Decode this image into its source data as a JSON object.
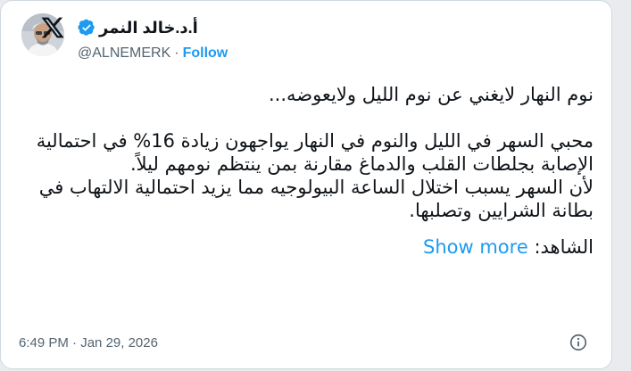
{
  "author": {
    "display_name": "أ.د.خالد النمر",
    "handle": "@ALNEMERK",
    "separator": "·",
    "follow_label": "Follow"
  },
  "tweet": {
    "paragraphs": [
      "نوم النهار لايغني عن نوم الليل ولايعوضه...",
      "",
      "محبي السهر في الليل والنوم في النهار يواجهون زيادة 16% في احتمالية الإصابة بجلطات القلب والدماغ مقارنة بمن ينتظم نومهم ليلاً.",
      "لأن السهر يسبب اختلال الساعة البيولوجيه مما يزيد احتمالية الالتهاب في بطانة الشرايين وتصلبها."
    ],
    "witness_label": "الشاهد:",
    "show_more_label": "Show more"
  },
  "footer": {
    "time": "6:49 PM",
    "separator": "·",
    "date": "Jan 29, 2026"
  },
  "colors": {
    "link": "#1d9bf0",
    "text": "#0f1419",
    "muted": "#536471",
    "border": "#cfd9de"
  },
  "icons": {
    "logo": "x-logo-icon",
    "verified": "verified-badge-icon",
    "info": "info-icon"
  }
}
